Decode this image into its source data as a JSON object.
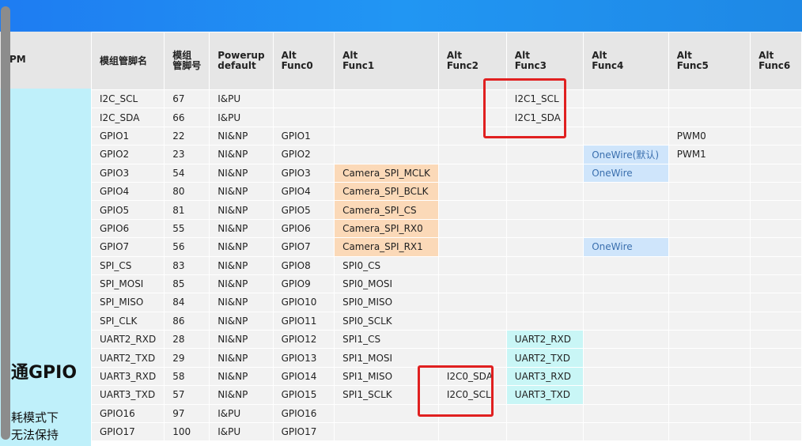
{
  "left_panel": {
    "header_fragment": "PM",
    "section_title": "通GPIO",
    "note_line1": "耗模式下",
    "note_line2": "无法保持"
  },
  "table": {
    "headers": [
      {
        "line1": "模组管脚名",
        "line2": ""
      },
      {
        "line1": "模组",
        "line2": "管脚号"
      },
      {
        "line1": "Powerup",
        "line2": "default"
      },
      {
        "line1": "Alt",
        "line2": "Func0"
      },
      {
        "line1": "Alt",
        "line2": "Func1"
      },
      {
        "line1": "Alt",
        "line2": "Func2"
      },
      {
        "line1": "Alt",
        "line2": "Func3"
      },
      {
        "line1": "Alt",
        "line2": "Func4"
      },
      {
        "line1": "Alt",
        "line2": "Func5"
      },
      {
        "line1": "Alt",
        "line2": "Func6"
      }
    ],
    "rows": [
      {
        "name": "I2C_SCL",
        "num": "67",
        "pu": "I&PU",
        "f0": "",
        "f1": "",
        "f2": "",
        "f3": "I2C1_SCL",
        "f4": "",
        "f5": "",
        "f6": ""
      },
      {
        "name": "I2C_SDA",
        "num": "66",
        "pu": "I&PU",
        "f0": "",
        "f1": "",
        "f2": "",
        "f3": "I2C1_SDA",
        "f4": "",
        "f5": "",
        "f6": ""
      },
      {
        "name": "GPIO1",
        "num": "22",
        "pu": "NI&NP",
        "f0": "GPIO1",
        "f1": "",
        "f2": "",
        "f3": "",
        "f4": "",
        "f5": "PWM0",
        "f6": ""
      },
      {
        "name": "GPIO2",
        "num": "23",
        "pu": "NI&NP",
        "f0": "GPIO2",
        "f1": "",
        "f2": "",
        "f3": "",
        "f4": "OneWire(默认)",
        "f5": "PWM1",
        "f6": ""
      },
      {
        "name": "GPIO3",
        "num": "54",
        "pu": "NI&NP",
        "f0": "GPIO3",
        "f1": "Camera_SPI_MCLK",
        "f2": "",
        "f3": "",
        "f4": "OneWire",
        "f5": "",
        "f6": ""
      },
      {
        "name": "GPIO4",
        "num": "80",
        "pu": "NI&NP",
        "f0": "GPIO4",
        "f1": "Camera_SPI_BCLK",
        "f2": "",
        "f3": "",
        "f4": "",
        "f5": "",
        "f6": ""
      },
      {
        "name": "GPIO5",
        "num": "81",
        "pu": "NI&NP",
        "f0": "GPIO5",
        "f1": "Camera_SPI_CS",
        "f2": "",
        "f3": "",
        "f4": "",
        "f5": "",
        "f6": ""
      },
      {
        "name": "GPIO6",
        "num": "55",
        "pu": "NI&NP",
        "f0": "GPIO6",
        "f1": "Camera_SPI_RX0",
        "f2": "",
        "f3": "",
        "f4": "",
        "f5": "",
        "f6": ""
      },
      {
        "name": "GPIO7",
        "num": "56",
        "pu": "NI&NP",
        "f0": "GPIO7",
        "f1": "Camera_SPI_RX1",
        "f2": "",
        "f3": "",
        "f4": "OneWire",
        "f5": "",
        "f6": ""
      },
      {
        "name": "SPI_CS",
        "num": "83",
        "pu": "NI&NP",
        "f0": "GPIO8",
        "f1": "SPI0_CS",
        "f2": "",
        "f3": "",
        "f4": "",
        "f5": "",
        "f6": ""
      },
      {
        "name": "SPI_MOSI",
        "num": "85",
        "pu": "NI&NP",
        "f0": "GPIO9",
        "f1": "SPI0_MOSI",
        "f2": "",
        "f3": "",
        "f4": "",
        "f5": "",
        "f6": ""
      },
      {
        "name": "SPI_MISO",
        "num": "84",
        "pu": "NI&NP",
        "f0": "GPIO10",
        "f1": "SPI0_MISO",
        "f2": "",
        "f3": "",
        "f4": "",
        "f5": "",
        "f6": ""
      },
      {
        "name": "SPI_CLK",
        "num": "86",
        "pu": "NI&NP",
        "f0": "GPIO11",
        "f1": "SPI0_SCLK",
        "f2": "",
        "f3": "",
        "f4": "",
        "f5": "",
        "f6": ""
      },
      {
        "name": "UART2_RXD",
        "num": "28",
        "pu": "NI&NP",
        "f0": "GPIO12",
        "f1": "SPI1_CS",
        "f2": "",
        "f3": "UART2_RXD",
        "f4": "",
        "f5": "",
        "f6": ""
      },
      {
        "name": "UART2_TXD",
        "num": "29",
        "pu": "NI&NP",
        "f0": "GPIO13",
        "f1": "SPI1_MOSI",
        "f2": "",
        "f3": "UART2_TXD",
        "f4": "",
        "f5": "",
        "f6": ""
      },
      {
        "name": "UART3_RXD",
        "num": "58",
        "pu": "NI&NP",
        "f0": "GPIO14",
        "f1": "SPI1_MISO",
        "f2": "I2C0_SDA",
        "f3": "UART3_RXD",
        "f4": "",
        "f5": "",
        "f6": ""
      },
      {
        "name": "UART3_TXD",
        "num": "57",
        "pu": "NI&NP",
        "f0": "GPIO15",
        "f1": "SPI1_SCLK",
        "f2": "I2C0_SCL",
        "f3": "UART3_TXD",
        "f4": "",
        "f5": "",
        "f6": ""
      },
      {
        "name": "GPIO16",
        "num": "97",
        "pu": "I&PU",
        "f0": "GPIO16",
        "f1": "",
        "f2": "",
        "f3": "",
        "f4": "",
        "f5": "",
        "f6": ""
      },
      {
        "name": "GPIO17",
        "num": "100",
        "pu": "I&PU",
        "f0": "GPIO17",
        "f1": "",
        "f2": "",
        "f3": "",
        "f4": "",
        "f5": "",
        "f6": ""
      }
    ]
  },
  "colors": {
    "topbar": "#1e88e5",
    "header_bg": "#e6e6e6",
    "cell_bg": "#f2f2f2",
    "left_col_bg": "#bff0fa",
    "highlight_orange": "#fbd9b8",
    "highlight_blue": "#cfe5fb",
    "highlight_cyan": "#c9f6f6",
    "annotation_red": "#e02020"
  }
}
